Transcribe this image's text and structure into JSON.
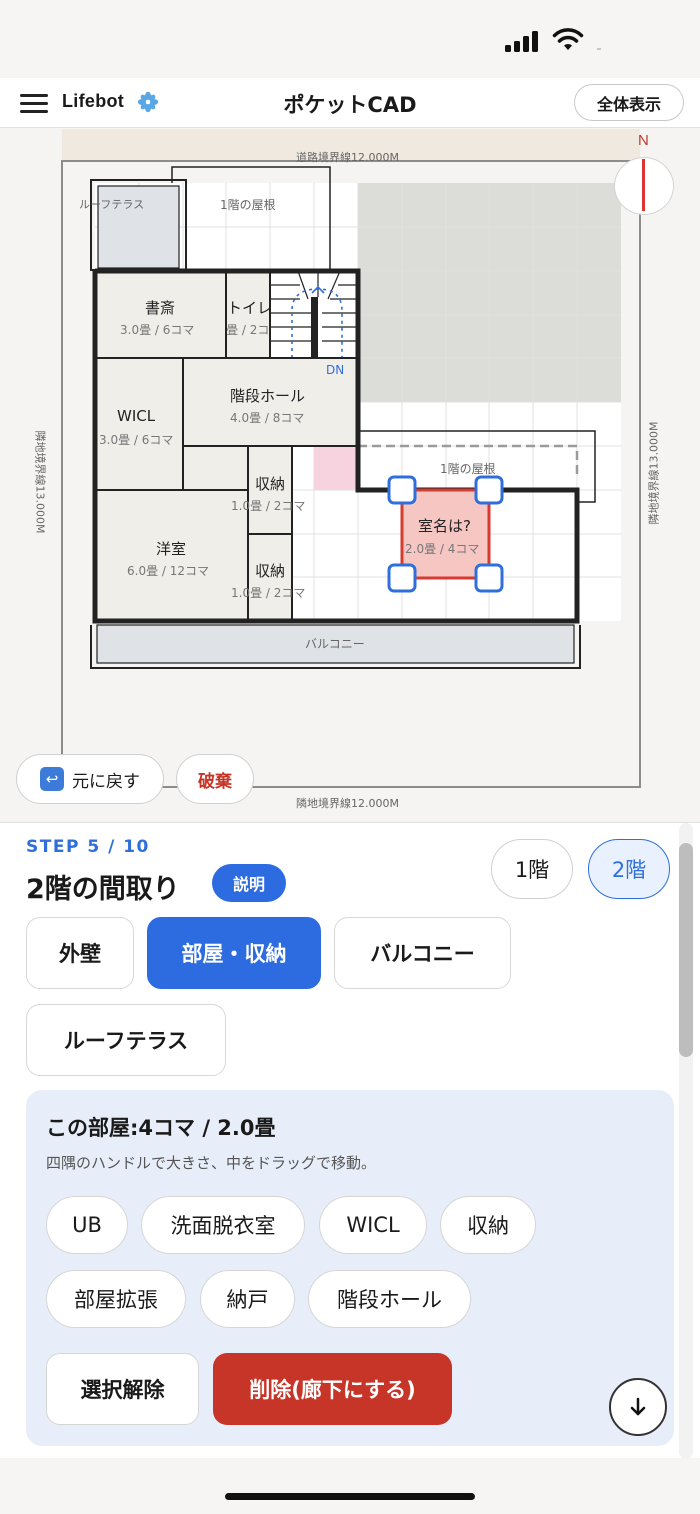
{
  "header": {
    "brand": "Lifebot",
    "title": "ポケットCAD",
    "fit_button": "全体表示"
  },
  "canvas": {
    "compass_label": "N",
    "boundary_top": "道路境界線12.000M",
    "boundary_bottom": "隣地境界線12.000M",
    "boundary_left": "隣地境界線13.000M",
    "boundary_right": "隣地境界線13.000M",
    "labels": {
      "roof_terrace": "ルーフテラス",
      "roof_1f_top": "1階の屋根",
      "roof_1f_mid": "1階の屋根",
      "balcony": "バルコニー",
      "dn": "DN"
    },
    "rooms": [
      {
        "name": "書斎",
        "size": "3.0畳 / 6コマ"
      },
      {
        "name": "トイレ",
        "size": "1.0畳 / 2コマ"
      },
      {
        "name": "WICL",
        "size": "3.0畳 / 6コマ"
      },
      {
        "name": "階段ホール",
        "size": "4.0畳 / 8コマ"
      },
      {
        "name": "収納",
        "size": "1.0畳 / 2コマ"
      },
      {
        "name": "洋室",
        "size": "6.0畳 / 12コマ"
      },
      {
        "name": "収納",
        "size": "1.0畳 / 2コマ"
      },
      {
        "name": "室名は?",
        "size": "2.0畳 / 4コマ"
      }
    ],
    "undo_button": "元に戻す",
    "discard_button": "破棄"
  },
  "panel": {
    "step": "STEP 5 / 10",
    "title": "2階の間取り",
    "explain_button": "説明",
    "floor_buttons": [
      {
        "label": "1階",
        "active": false
      },
      {
        "label": "2階",
        "active": true
      }
    ],
    "tools": [
      {
        "label": "外壁",
        "active": false
      },
      {
        "label": "部屋・収納",
        "active": true
      },
      {
        "label": "バルコニー",
        "active": false
      },
      {
        "label": "ルーフテラス",
        "active": false
      }
    ],
    "room_card": {
      "title": "この部屋:4コマ / 2.0畳",
      "subtitle": "四隅のハンドルで大きさ、中をドラッグで移動。",
      "chips": [
        "UB",
        "洗面脱衣室",
        "WICL",
        "収納",
        "部屋拡張",
        "納戸",
        "階段ホール"
      ],
      "clear_button": "選択解除",
      "delete_button": "削除(廊下にする)"
    }
  },
  "colors": {
    "accent": "#2d6ce0",
    "danger": "#c63527",
    "selected_room_fill": "#f6c6c3"
  }
}
